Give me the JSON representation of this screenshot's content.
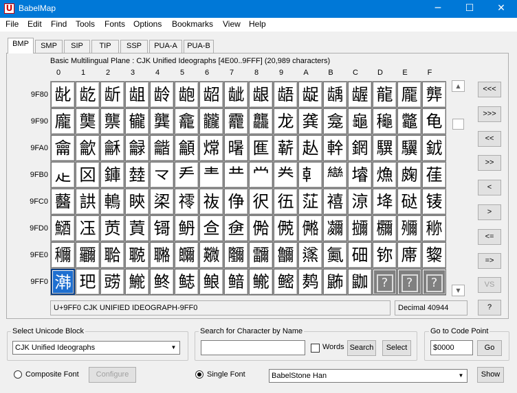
{
  "window": {
    "title": "BabelMap",
    "icon_letter": "U",
    "minimize": "─",
    "maximize": "☐",
    "close": "✕"
  },
  "menu": [
    "File",
    "Edit",
    "Find",
    "Tools",
    "Fonts",
    "Options",
    "Bookmarks",
    "View",
    "Help"
  ],
  "tabs": [
    "BMP",
    "SMP",
    "SIP",
    "TIP",
    "SSP",
    "PUA-A",
    "PUA-B"
  ],
  "active_tab": "BMP",
  "block_info": "Basic Multilingual Plane : CJK Unified Ideographs [4E00..9FFF] (20,989 characters)",
  "column_headers": [
    "0",
    "1",
    "2",
    "3",
    "4",
    "5",
    "6",
    "7",
    "8",
    "9",
    "A",
    "B",
    "C",
    "D",
    "E",
    "F"
  ],
  "row_headers": [
    "9F80",
    "9F90",
    "9FA0",
    "9FB0",
    "9FC0",
    "9FD0",
    "9FE0",
    "9FF0"
  ],
  "grid": [
    [
      "龀",
      "龁",
      "龂",
      "龃",
      "龄",
      "龅",
      "龆",
      "龇",
      "龈",
      "龉",
      "龊",
      "龋",
      "龌",
      "龍",
      "龎",
      "龏"
    ],
    [
      "龐",
      "龑",
      "龒",
      "龓",
      "龔",
      "龕",
      "龖",
      "龗",
      "龘",
      "龙",
      "龚",
      "龛",
      "龜",
      "龝",
      "龞",
      "龟"
    ],
    [
      "龠",
      "龡",
      "龢",
      "龣",
      "龤",
      "龥",
      "龦",
      "龧",
      "龨",
      "龩",
      "龪",
      "龫",
      "龬",
      "龭",
      "龮",
      "龯"
    ],
    [
      "龰",
      "龱",
      "龲",
      "龳",
      "龴",
      "龵",
      "龶",
      "龷",
      "龸",
      "龹",
      "龺",
      "龻",
      "龼",
      "龽",
      "龾",
      "龿"
    ],
    [
      "鿀",
      "鿁",
      "鿂",
      "鿃",
      "鿄",
      "鿅",
      "鿆",
      "鿇",
      "鿈",
      "鿉",
      "鿊",
      "鿋",
      "鿌",
      "鿍",
      "鿎",
      "鿏"
    ],
    [
      "鿐",
      "鿑",
      "鿒",
      "鿓",
      "鿔",
      "鿕",
      "鿖",
      "鿗",
      "鿘",
      "鿙",
      "鿚",
      "鿛",
      "鿜",
      "鿝",
      "鿞",
      "鿟"
    ],
    [
      "鿠",
      "鿡",
      "鿢",
      "鿣",
      "鿤",
      "鿥",
      "鿦",
      "鿧",
      "鿨",
      "鿩",
      "鿪",
      "鿫",
      "鿬",
      "鿭",
      "鿮",
      "鿯"
    ],
    [
      "鿰",
      "鿱",
      "鿲",
      "鿳",
      "鿴",
      "鿵",
      "鿶",
      "鿷",
      "鿸",
      "鿹",
      "鿺",
      "鿻",
      "鿼",
      "?",
      "?",
      "?"
    ]
  ],
  "selected_cell": {
    "row": 7,
    "col": 0
  },
  "unassigned_marker": "?",
  "scrollbar": {
    "up": "▲",
    "down": "▼"
  },
  "nav_buttons": [
    "<<<",
    ">>>",
    "<<",
    ">>",
    "<",
    ">",
    "<=",
    "=>",
    "VS",
    "?"
  ],
  "status": {
    "char_name": "U+9FF0 CJK UNIFIED IDEOGRAPH-9FF0",
    "decimal": "Decimal 40944"
  },
  "block_group": {
    "label": "Select Unicode Block",
    "value": "CJK Unified Ideographs"
  },
  "search_group": {
    "label": "Search for Character by Name",
    "value": "",
    "words_label": "Words",
    "search_button": "Search",
    "select_button": "Select"
  },
  "goto_group": {
    "label": "Go to Code Point",
    "value": "$0000",
    "go_button": "Go"
  },
  "font_options": {
    "composite_label": "Composite Font",
    "configure_button": "Configure",
    "single_label": "Single Font",
    "font_value": "BabelStone Han",
    "show_button": "Show"
  },
  "combo_arrow": "▼",
  "colors": {
    "titlebar": "#0078d7",
    "selected_cell": "#1e6fd0",
    "unassigned_cell": "#808080"
  }
}
